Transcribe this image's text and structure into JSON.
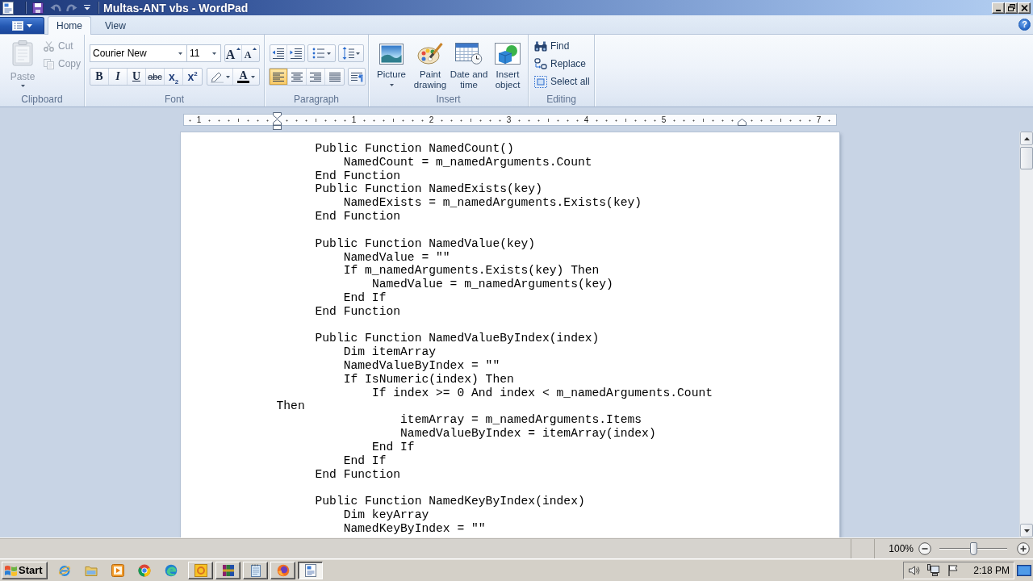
{
  "title_bar": {
    "title": "Multas-ANT vbs - WordPad",
    "quick_access": [
      {
        "kind": "save",
        "disabled": false
      },
      {
        "kind": "undo",
        "disabled": true
      },
      {
        "kind": "redo",
        "disabled": true
      }
    ]
  },
  "tabs": [
    {
      "label": "Home",
      "selected": true
    },
    {
      "label": "View",
      "selected": false
    }
  ],
  "help": {
    "label": "?"
  },
  "ribbon": {
    "clipboard": {
      "label": "Clipboard",
      "paste": {
        "label": "Paste",
        "disabled": true
      },
      "actions": [
        {
          "kind": "cut",
          "label": "Cut",
          "disabled": true
        },
        {
          "kind": "copy",
          "label": "Copy",
          "disabled": true
        }
      ]
    },
    "font": {
      "label": "Font",
      "font_name": "Courier New",
      "font_size": "11",
      "size_buttons": [
        {
          "kind": "grow",
          "label": "A"
        },
        {
          "kind": "shrink",
          "label": "A"
        }
      ],
      "format_buttons": [
        {
          "kind": "bold",
          "label": "B"
        },
        {
          "kind": "italic",
          "label": "I"
        },
        {
          "kind": "underline",
          "label": "U"
        },
        {
          "kind": "strikethrough",
          "label": "abc"
        },
        {
          "kind": "subscript",
          "label": "x$_{2}$"
        },
        {
          "kind": "superscript",
          "label": "x$^{2}$"
        }
      ],
      "font_color": {
        "label": "A"
      }
    },
    "paragraph": {
      "label": "Paragraph",
      "alignments": [
        {
          "kind": "left",
          "selected": true
        },
        {
          "kind": "center",
          "selected": false
        },
        {
          "kind": "right",
          "selected": false
        },
        {
          "kind": "justify",
          "selected": false
        }
      ]
    },
    "insert": {
      "label": "Insert",
      "items": [
        {
          "kind": "picture",
          "label": "Picture"
        },
        {
          "kind": "paint",
          "label": "Paint drawing"
        },
        {
          "kind": "datetime",
          "label": "Date and time"
        },
        {
          "kind": "object",
          "label": "Insert object"
        }
      ]
    },
    "editing": {
      "label": "Editing",
      "items": [
        {
          "kind": "find",
          "label": "Find"
        },
        {
          "kind": "replace",
          "label": "Replace"
        },
        {
          "kind": "select_all",
          "label": "Select all"
        }
      ]
    }
  },
  "ruler": {
    "labels": [
      "1",
      "1",
      "2",
      "3",
      "4",
      "5",
      "7"
    ]
  },
  "document": {
    "blocks": [
      {
        "lines": [
          "\tPublic Function NamedCount()",
          "\t    NamedCount = m_namedArguments.Count",
          "\tEnd Function",
          "\tPublic Function NamedExists(key)",
          "\t    NamedExists = m_namedArguments.Exists(key)",
          "\tEnd Function"
        ]
      },
      {
        "lines": [
          "\tPublic Function NamedValue(key)",
          "\t    NamedValue = \"\"",
          "\t    If m_namedArguments.Exists(key) Then",
          "\t        NamedValue = m_namedArguments(key)",
          "\t    End If",
          "\tEnd Function"
        ]
      },
      {
        "lines": [
          "\tPublic Function NamedValueByIndex(index)",
          "\t    Dim itemArray",
          "\t    NamedValueByIndex = \"\"",
          "\t    If IsNumeric(index) Then",
          "\t        If index >= 0 And index < m_namedArguments.Count Then",
          "\t            itemArray = m_namedArguments.Items",
          "\t            NamedValueByIndex = itemArray(index)",
          "\t        End If",
          "\t    End If",
          "\tEnd Function"
        ]
      },
      {
        "lines": [
          "\tPublic Function NamedKeyByIndex(index)",
          "\t    Dim keyArray",
          "\t    NamedKeyByIndex = \"\""
        ]
      }
    ]
  },
  "status_bar": {
    "zoom": "100%",
    "zoom_slider": {
      "level": 0.5
    }
  },
  "taskbar": {
    "start": "Start",
    "quick_launch": [
      {
        "kind": "ie"
      },
      {
        "kind": "explorer"
      },
      {
        "kind": "media"
      },
      {
        "kind": "chrome"
      },
      {
        "kind": "edge"
      }
    ],
    "tasks": [
      {
        "kind": "ring_app",
        "selected": false
      },
      {
        "kind": "winrar",
        "selected": false
      },
      {
        "kind": "notepad",
        "selected": false
      },
      {
        "kind": "firefox",
        "selected": false
      },
      {
        "kind": "wordpad",
        "selected": true
      }
    ],
    "clock": "2:18 PM"
  }
}
